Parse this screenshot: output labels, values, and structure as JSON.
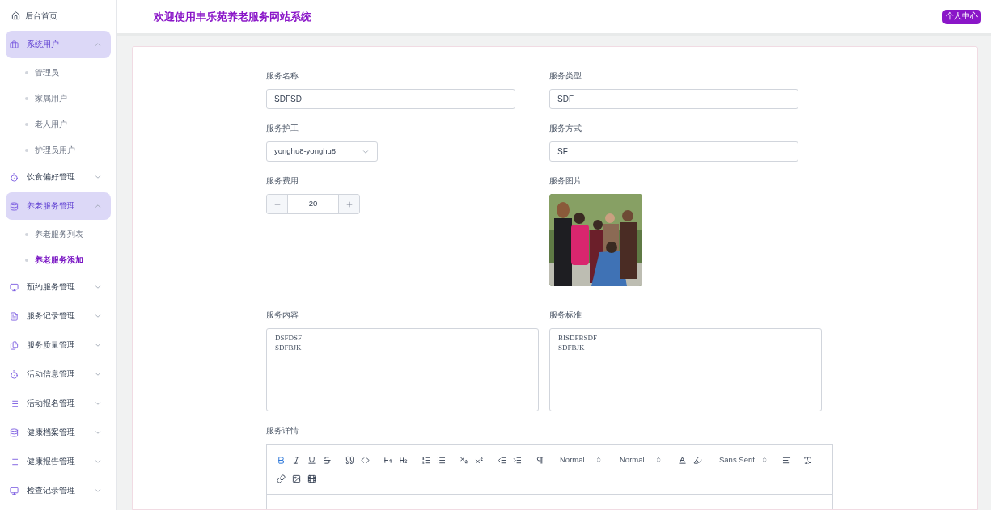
{
  "sidebar": {
    "home": "后台首页",
    "items": [
      {
        "label": "系统用户",
        "expanded": true,
        "children": [
          {
            "label": "管理员",
            "selected": false
          },
          {
            "label": "家属用户",
            "selected": false
          },
          {
            "label": "老人用户",
            "selected": false
          },
          {
            "label": "护理员用户",
            "selected": false
          }
        ]
      },
      {
        "label": "饮食偏好管理",
        "expanded": false
      },
      {
        "label": "养老服务管理",
        "expanded": true,
        "children": [
          {
            "label": "养老服务列表",
            "selected": false
          },
          {
            "label": "养老服务添加",
            "selected": true
          }
        ]
      },
      {
        "label": "预约服务管理",
        "expanded": false
      },
      {
        "label": "服务记录管理",
        "expanded": false
      },
      {
        "label": "服务质量管理",
        "expanded": false
      },
      {
        "label": "活动信息管理",
        "expanded": false
      },
      {
        "label": "活动报名管理",
        "expanded": false
      },
      {
        "label": "健康档案管理",
        "expanded": false
      },
      {
        "label": "健康报告管理",
        "expanded": false
      },
      {
        "label": "检查记录管理",
        "expanded": false
      }
    ]
  },
  "header": {
    "title": "欢迎使用丰乐苑养老服务网站系统",
    "user_button": "个人中心"
  },
  "form": {
    "name": {
      "label": "服务名称",
      "value": "SDFSD"
    },
    "type": {
      "label": "服务类型",
      "value": "SDF"
    },
    "nurse": {
      "label": "服务护工",
      "value": "yonghu8-yonghu8"
    },
    "method": {
      "label": "服务方式",
      "value": "SF"
    },
    "fee": {
      "label": "服务费用",
      "value": "20"
    },
    "image": {
      "label": "服务图片",
      "kind": "picture"
    },
    "content": {
      "label": "服务内容",
      "lines": [
        "DSFDSF",
        "SDFBJK"
      ]
    },
    "standard": {
      "label": "服务标准",
      "lines": [
        "BISDFBSDF",
        "SDFBJK"
      ]
    },
    "details": {
      "label": "服务详情",
      "bold_active": true,
      "header_picker": "Normal",
      "size_picker": "Normal",
      "font_picker": "Sans Serif"
    }
  }
}
